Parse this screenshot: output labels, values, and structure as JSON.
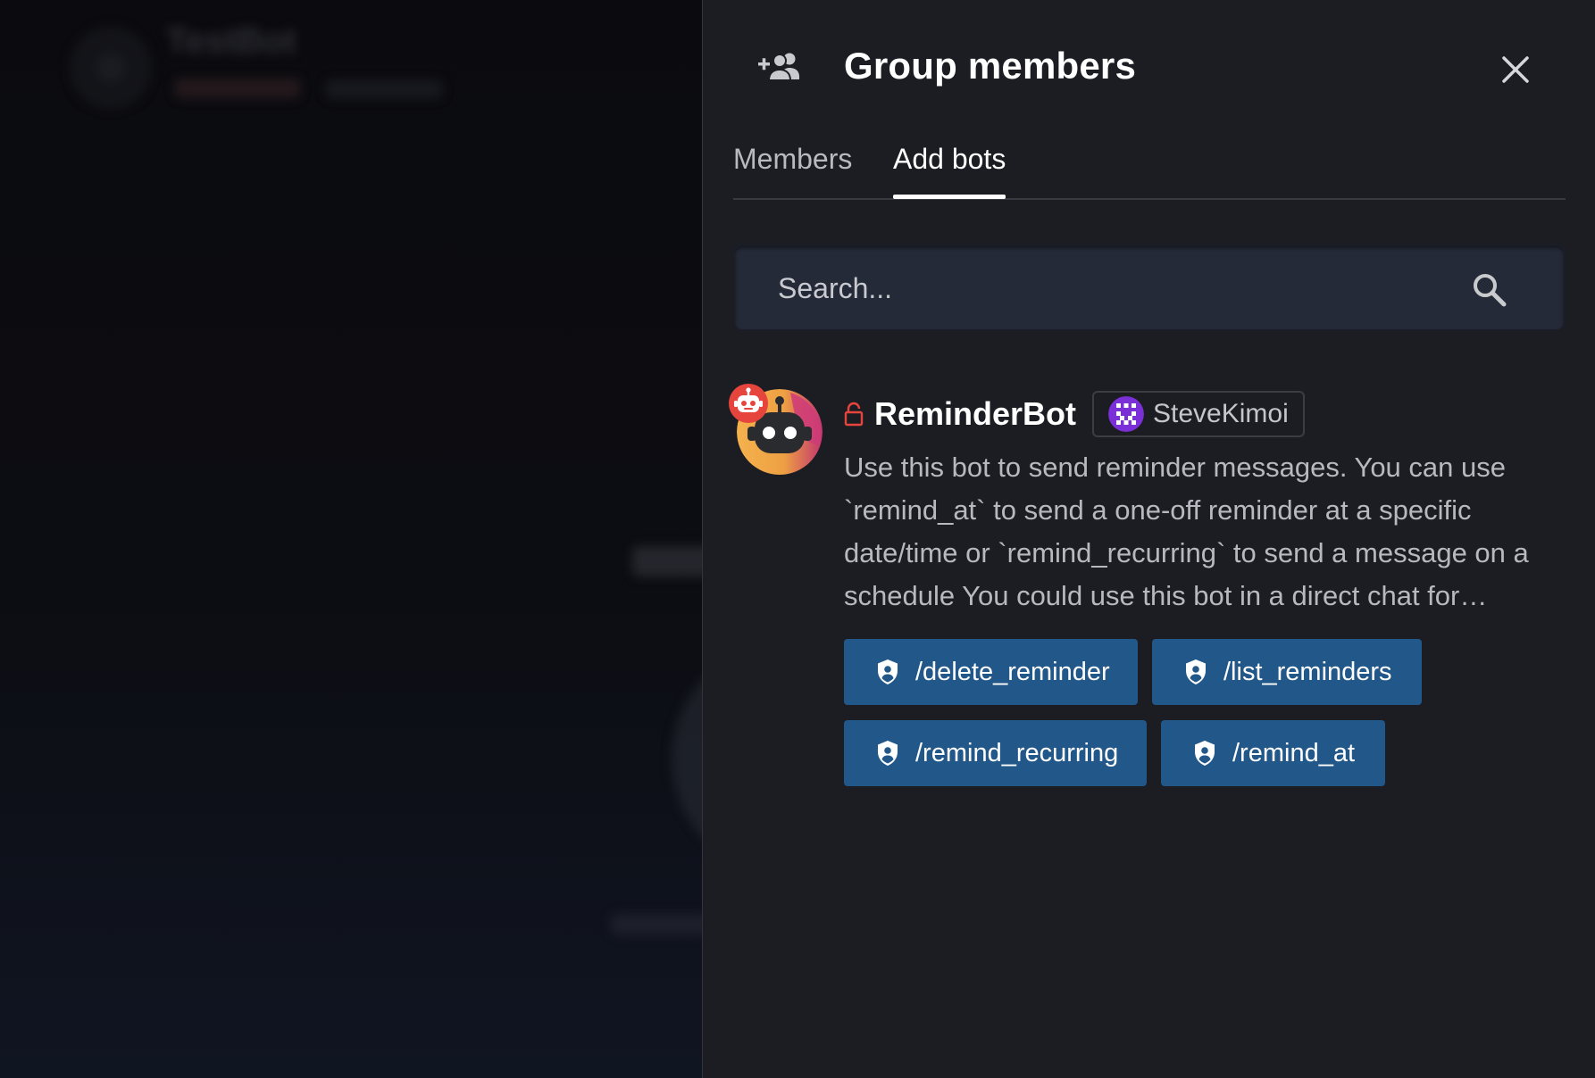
{
  "background_chat": {
    "title": "TestBot"
  },
  "panel": {
    "title": "Group members",
    "add_member_icon": "add-group-member-icon",
    "close_icon": "close-icon"
  },
  "tabs": [
    {
      "label": "Members",
      "active": false
    },
    {
      "label": "Add bots",
      "active": true
    }
  ],
  "search": {
    "placeholder": "Search...",
    "value": "",
    "icon": "search-icon"
  },
  "bot": {
    "name": "ReminderBot",
    "badge_icon": "robot-icon",
    "lock_icon": "lock-open-icon",
    "owner": {
      "name": "SteveKimoi",
      "avatar_icon": "identicon-avatar"
    },
    "description": "Use this bot to send reminder messages. You can use `remind_at` to send a one-off reminder at a specific date/time or `remind_recurring` to send a message on a schedule You could use this bot in a direct chat for…",
    "commands": [
      {
        "label": "/delete_reminder",
        "icon": "shield-user-icon"
      },
      {
        "label": "/list_reminders",
        "icon": "shield-user-icon"
      },
      {
        "label": "/remind_recurring",
        "icon": "shield-user-icon"
      },
      {
        "label": "/remind_at",
        "icon": "shield-user-icon"
      }
    ]
  },
  "colors": {
    "panel_bg": "#1c1d22",
    "command_button": "#225889",
    "badge_red": "#e5453d",
    "lock_red": "#e5453d",
    "avatar_orange": "#f2a541",
    "avatar_pink": "#d4367a",
    "owner_avatar_purple": "#8a2be2"
  }
}
